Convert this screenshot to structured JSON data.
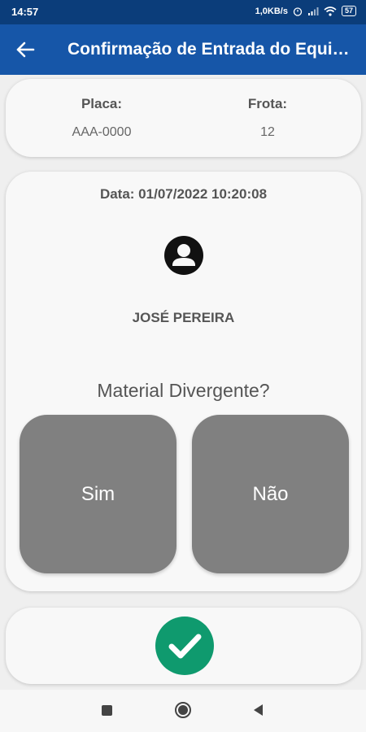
{
  "status_bar": {
    "time": "14:57",
    "speed": "1,0KB/s",
    "battery": "57"
  },
  "app_bar": {
    "title": "Confirmação de Entrada do Equipamento"
  },
  "info": {
    "placa_label": "Placa:",
    "placa_value": "AAA-0000",
    "frota_label": "Frota:",
    "frota_value": "12"
  },
  "main": {
    "date": "Data: 01/07/2022 10:20:08",
    "person_name": "JOSÉ PEREIRA",
    "question": "Material Divergente?",
    "yes_label": "Sim",
    "no_label": "Não"
  },
  "icons": {
    "back": "arrow-back-icon",
    "avatar": "account-circle-icon",
    "confirm": "check-icon",
    "nav_recents": "square-icon",
    "nav_home": "circle-icon",
    "nav_back": "triangle-back-icon"
  },
  "colors": {
    "status_bar": "#0b3d7a",
    "app_bar": "#1656a8",
    "choice_button": "#808080",
    "confirm_button": "#0f9a6e"
  }
}
